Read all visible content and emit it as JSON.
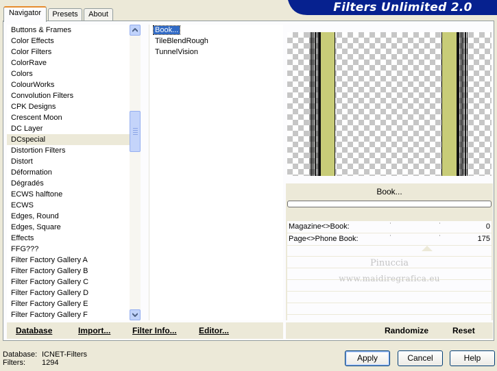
{
  "window": {
    "title": "Filters Unlimited 2.0",
    "banner_color": "#06218f"
  },
  "tabs": [
    {
      "label": "Navigator",
      "active": true
    },
    {
      "label": "Presets",
      "active": false
    },
    {
      "label": "About",
      "active": false
    }
  ],
  "categories": {
    "selected": "DCspecial",
    "items": [
      "Buttons & Frames",
      "Color Effects",
      "Color Filters",
      "ColorRave",
      "Colors",
      "ColourWorks",
      "Convolution Filters",
      "CPK Designs",
      "Crescent Moon",
      "DC Layer",
      "DCspecial",
      "Distortion Filters",
      "Distort",
      "Déformation",
      "Dégradés",
      "ECWS halftone",
      "ECWS",
      "Edges, Round",
      "Edges, Square",
      "Effects",
      "FFG???",
      "Filter Factory Gallery A",
      "Filter Factory Gallery B",
      "Filter Factory Gallery C",
      "Filter Factory Gallery D",
      "Filter Factory Gallery E",
      "Filter Factory Gallery F"
    ]
  },
  "filters": {
    "selected": "Book...",
    "items": [
      "Book...",
      "TileBlendRough",
      "TunnelVision"
    ]
  },
  "preview": {
    "stripe_color": "#c8cc78",
    "line_color": "#111111"
  },
  "current_filter": {
    "name": "Book...",
    "progress": 0
  },
  "parameters": [
    {
      "label": "Magazine<>Book:",
      "value": "0",
      "level": 0
    },
    {
      "label": "Page<>Phone Book:",
      "value": "175",
      "level": 0.686
    }
  ],
  "watermark": {
    "line1": "Pinuccia",
    "line2": "www.maidiregrafica.eu"
  },
  "bottom_bar": {
    "database": "Database",
    "import": "Import...",
    "filter_info": "Filter Info...",
    "editor": "Editor...",
    "randomize": "Randomize",
    "reset": "Reset"
  },
  "status": {
    "database_label": "Database:",
    "database_value": "ICNET-Filters",
    "filters_label": "Filters:",
    "filters_value": "1294"
  },
  "dialog": {
    "apply": "Apply",
    "cancel": "Cancel",
    "help": "Help"
  }
}
